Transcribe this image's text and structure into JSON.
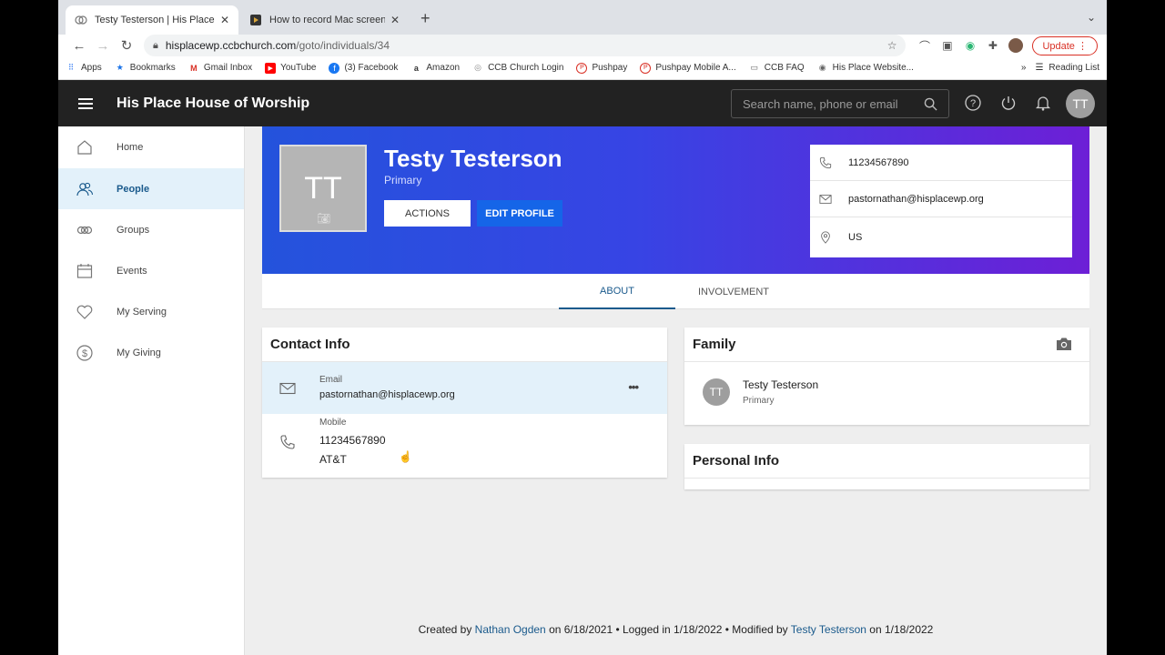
{
  "browser": {
    "tabs": [
      {
        "title": "Testy Testerson | His Place Hou",
        "close": "✕"
      },
      {
        "title": "How to record Mac screen with",
        "close": "✕"
      }
    ],
    "new_tab": "+",
    "url_host": "hisplacewp.ccbchurch.com",
    "url_path": "/goto/individuals/34",
    "update_label": "Update",
    "bookmarks": [
      {
        "label": "Apps",
        "icon": "apps-grid-icon"
      },
      {
        "label": "Bookmarks",
        "icon": "star-icon"
      },
      {
        "label": "Gmail Inbox",
        "icon": "gmail-icon"
      },
      {
        "label": "YouTube",
        "icon": "youtube-icon"
      },
      {
        "label": "(3) Facebook",
        "icon": "facebook-icon"
      },
      {
        "label": "Amazon",
        "icon": "amazon-icon"
      },
      {
        "label": "CCB Church Login",
        "icon": "ccb-icon"
      },
      {
        "label": "Pushpay",
        "icon": "pushpay-icon"
      },
      {
        "label": "Pushpay Mobile A...",
        "icon": "pushpay-icon"
      },
      {
        "label": "CCB FAQ",
        "icon": "folder-icon"
      },
      {
        "label": "His Place Website...",
        "icon": "website-icon"
      }
    ],
    "bookmarks_more": "»",
    "reading_list": "Reading List"
  },
  "app": {
    "church_name": "His Place House of Worship",
    "search_placeholder": "Search name, phone or email",
    "user_initials": "TT"
  },
  "sidebar": {
    "items": [
      {
        "label": "Home",
        "icon": "home-icon"
      },
      {
        "label": "People",
        "icon": "people-icon",
        "active": true
      },
      {
        "label": "Groups",
        "icon": "groups-icon"
      },
      {
        "label": "Events",
        "icon": "calendar-icon"
      },
      {
        "label": "My Serving",
        "icon": "heart-icon"
      },
      {
        "label": "My Giving",
        "icon": "dollar-icon"
      }
    ]
  },
  "profile": {
    "initials": "TT",
    "name": "Testy Testerson",
    "subtitle": "Primary",
    "actions_label": "ACTIONS",
    "edit_label": "EDIT PROFILE",
    "phone": "11234567890",
    "email": "pastornathan@hisplacewp.org",
    "location": "US"
  },
  "tabs": {
    "about": "ABOUT",
    "involvement": "INVOLVEMENT"
  },
  "contact_info": {
    "title": "Contact Info",
    "email_label": "Email",
    "email_value": "pastornathan@hisplacewp.org",
    "more": "•••",
    "mobile_label": "Mobile",
    "mobile_value": "11234567890",
    "carrier": "AT&T"
  },
  "family": {
    "title": "Family",
    "member_initials": "TT",
    "member_name": "Testy Testerson",
    "member_role": "Primary"
  },
  "personal_info": {
    "title": "Personal Info"
  },
  "footer": {
    "created_prefix": "Created by ",
    "created_by": "Nathan Ogden",
    "created_on": " on 6/18/2021 • Logged in 1/18/2022 • Modified by ",
    "modified_by": "Testy Testerson",
    "modified_on": " on 1/18/2022"
  },
  "colors": {
    "banner_start": "#2453dc",
    "banner_end": "#6d1fd6",
    "accent": "#1a5a8c",
    "edit_button": "#1565e8",
    "appbar": "#222222"
  }
}
